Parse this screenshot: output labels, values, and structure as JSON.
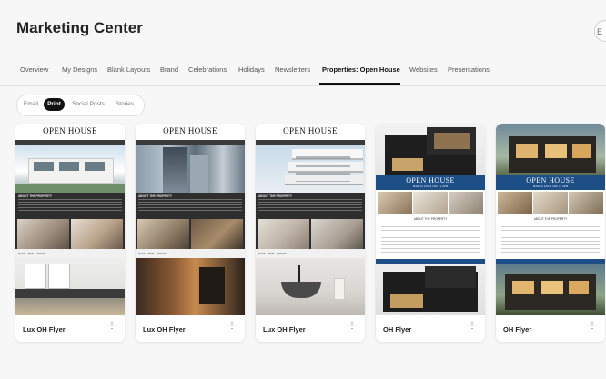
{
  "app": {
    "title": "Marketing Center",
    "top_button_label": "E"
  },
  "tabs": [
    {
      "label": "Overview",
      "active": false
    },
    {
      "label": "My Designs",
      "active": false
    },
    {
      "label": "Blank Layouts",
      "active": false
    },
    {
      "label": "Brand",
      "active": false
    },
    {
      "label": "Celebrations",
      "active": false
    },
    {
      "label": "Holidays",
      "active": false
    },
    {
      "label": "Newsletters",
      "active": false
    },
    {
      "label": "Properties: Open House",
      "active": true
    },
    {
      "label": "Websites",
      "active": false
    },
    {
      "label": "Presentations",
      "active": false
    }
  ],
  "filters": [
    {
      "label": "Email",
      "active": false
    },
    {
      "label": "Print",
      "active": true
    },
    {
      "label": "Social Posts",
      "active": false
    },
    {
      "label": "Stories",
      "active": false
    }
  ],
  "cards": [
    {
      "name": "Lux OH Flyer",
      "more_icon": "more-vertical-icon",
      "flyer_title": "OPEN HOUSE",
      "flyer_sub": "ABOUT THE PROPERTY",
      "flyer_bar": "DATE · TIME · OFFER"
    },
    {
      "name": "Lux OH Flyer",
      "more_icon": "more-vertical-icon",
      "flyer_title": "OPEN HOUSE",
      "flyer_sub": "ABOUT THE PROPERTY",
      "flyer_bar": "DATE · TIME · OFFER"
    },
    {
      "name": "Lux OH Flyer",
      "more_icon": "more-vertical-icon",
      "flyer_title": "OPEN HOUSE",
      "flyer_sub": "ABOUT THE PROPERTY",
      "flyer_bar": "DATE · TIME · OFFER"
    },
    {
      "name": "OH Flyer",
      "more_icon": "more-vertical-icon",
      "flyer_title": "OPEN HOUSE",
      "flyer_sub": "MARCH 12th & 13th | 1-4PM",
      "flyer_heading": "ABOUT THE PROPERTY"
    },
    {
      "name": "OH Flyer",
      "more_icon": "more-vertical-icon",
      "flyer_title": "OPEN HOUSE",
      "flyer_sub": "MARCH 12th & 13th | 1-4PM",
      "flyer_heading": "ABOUT THE PROPERTY"
    }
  ],
  "colors": {
    "accent": "#111111",
    "flyer_blue": "#1d4e86",
    "flyer_dark": "#2e2e2e"
  }
}
